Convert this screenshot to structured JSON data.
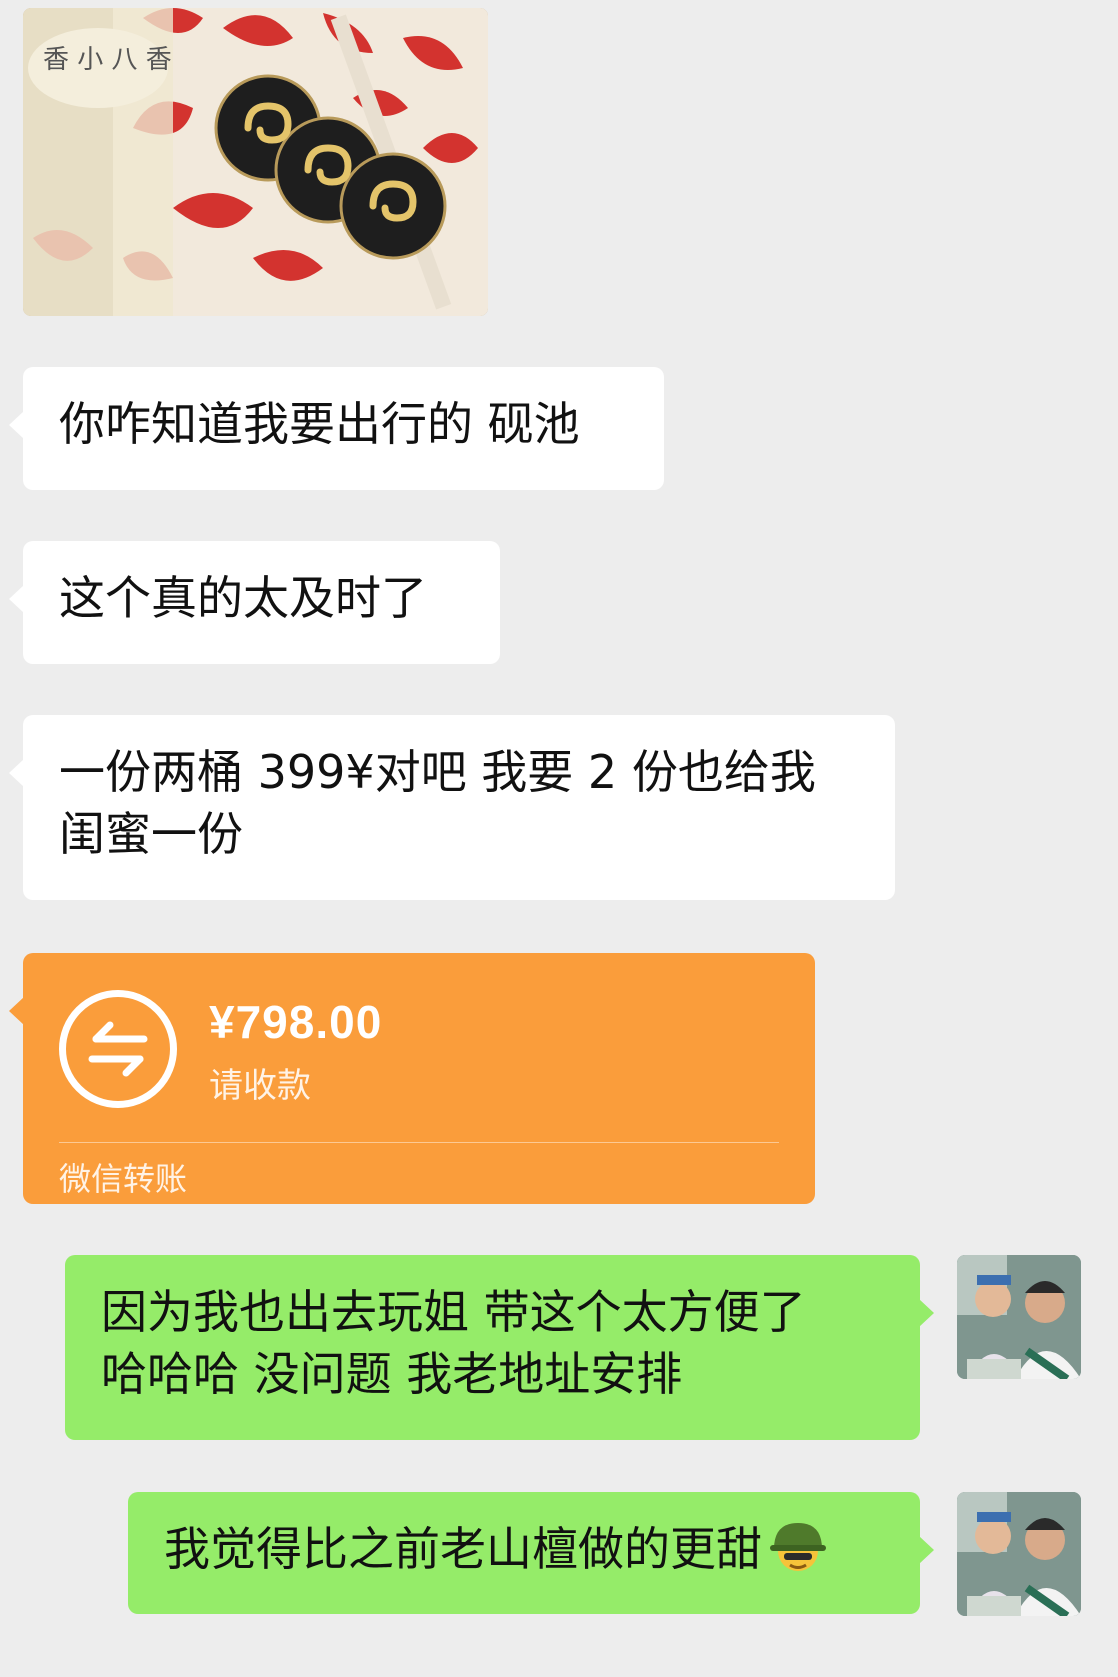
{
  "messages": {
    "m1": {
      "text": "你咋知道我要出行的 砚池"
    },
    "m2": {
      "text": "这个真的太及时了"
    },
    "m3": {
      "line1": "一份两桶 399¥对吧 我要 2 份也给我",
      "line2": "闺蜜一份"
    },
    "transfer": {
      "amount": "¥798.00",
      "status": "请收款",
      "footer": "微信转账"
    },
    "m5": {
      "line1": "因为我也出去玩姐 带这个太方便了",
      "line2": "哈哈哈 没问题 我老地址安排"
    },
    "m6": {
      "text": "我觉得比之前老山檀做的更甜",
      "emoji": "army-helmet-emoji"
    }
  },
  "photo": {
    "printed_text": "香 小 八 香"
  },
  "colors": {
    "background": "#ededed",
    "incoming_bubble": "#ffffff",
    "outgoing_bubble": "#95ec69",
    "transfer_card": "#fa9d3b"
  }
}
